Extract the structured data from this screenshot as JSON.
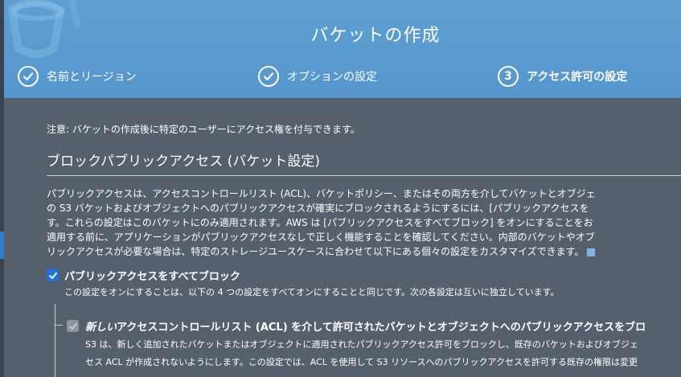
{
  "dialog": {
    "title": "バケットの作成"
  },
  "steps": [
    {
      "label": "名前とリージョン",
      "state": "done",
      "icon": "check-icon"
    },
    {
      "label": "オプションの設定",
      "state": "done",
      "icon": "check-icon"
    },
    {
      "number": "3",
      "label": "アクセス許可の設定",
      "state": "current"
    }
  ],
  "body": {
    "notice": "注意: バケットの作成後に特定のユーザーにアクセス権を付与できます。",
    "section_title": "ブロックパブリックアクセス (バケット設定)",
    "description_lines": [
      "パブリックアクセスは、アクセスコントロールリスト (ACL)、バケットポリシー、またはその両方を介してバケットとオブジェ",
      "の S3 バケットおよびオブジェクトへのパブリックアクセスが確実にブロックされるようにするには、[パブリックアクセスを",
      "す。これらの設定はこのバケットにのみ適用されます。AWS は [パブリックアクセスをすべてブロック] をオンにすることをお",
      "適用する前に、アプリケーションがパブリックアクセスなしで正しく機能することを確認してください。内部のバケットやオブ",
      "リックアクセスが必要な場合は、特定のストレージユースケースに合わせて以下にある個々の設定をカスタマイズできます。"
    ],
    "block_all": {
      "checked": true,
      "label": "パブリックアクセスをすべてブロック",
      "sublabel": "この設定をオンにすることは、以下の 4 つの設定をすべてオンにすることと同じです。次の各設定は互いに独立しています。"
    },
    "block_new_acl": {
      "checked": true,
      "disabled": true,
      "label_italic": "新しい",
      "label_rest": "アクセスコントロールリスト (ACL) を介して許可されたバケットとオブジェクトへのパブリックアクセスをブロ",
      "description_lines": [
        "S3 は、新しく追加されたバケットまたはオブジェクトに適用されたパブリックアクセス許可をブロックし、既存のバケットおよびオブジェ",
        "セス ACL が作成されないようにします。この設定では、ACL を使用して S3 リソースへのパブリックアクセスを許可する既存の権限は変更"
      ]
    }
  },
  "colors": {
    "header_bg": "#5596cc",
    "body_bg": "#56606c",
    "checkbox_accent": "#1a73e8"
  }
}
